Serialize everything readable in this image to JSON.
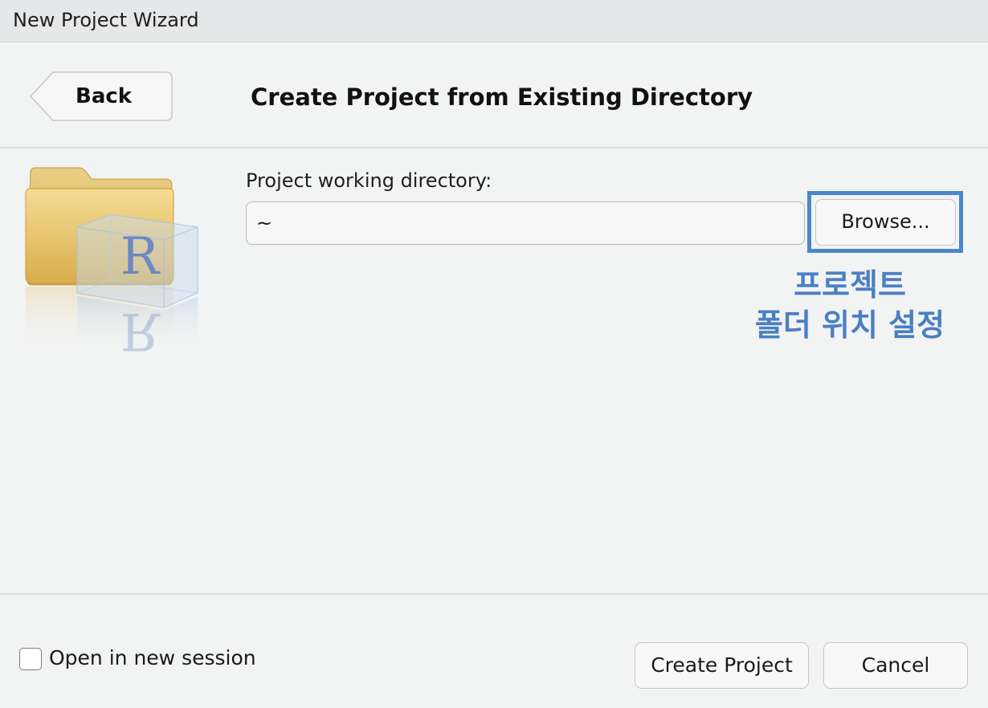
{
  "window": {
    "title": "New Project Wizard"
  },
  "header": {
    "back_label": "Back",
    "page_title": "Create Project from Existing Directory"
  },
  "form": {
    "directory_label": "Project working directory:",
    "directory_value": "~",
    "browse_label": "Browse..."
  },
  "annotation": {
    "line1": "프로젝트",
    "line2": "폴더 위치 설정",
    "color": "#4a7fc4",
    "box_color": "#4a89c8"
  },
  "footer": {
    "checkbox_label": "Open in new session",
    "checkbox_checked": false,
    "create_label": "Create Project",
    "cancel_label": "Cancel"
  },
  "icon": {
    "name": "r-project-folder-icon",
    "glyph": "R"
  }
}
